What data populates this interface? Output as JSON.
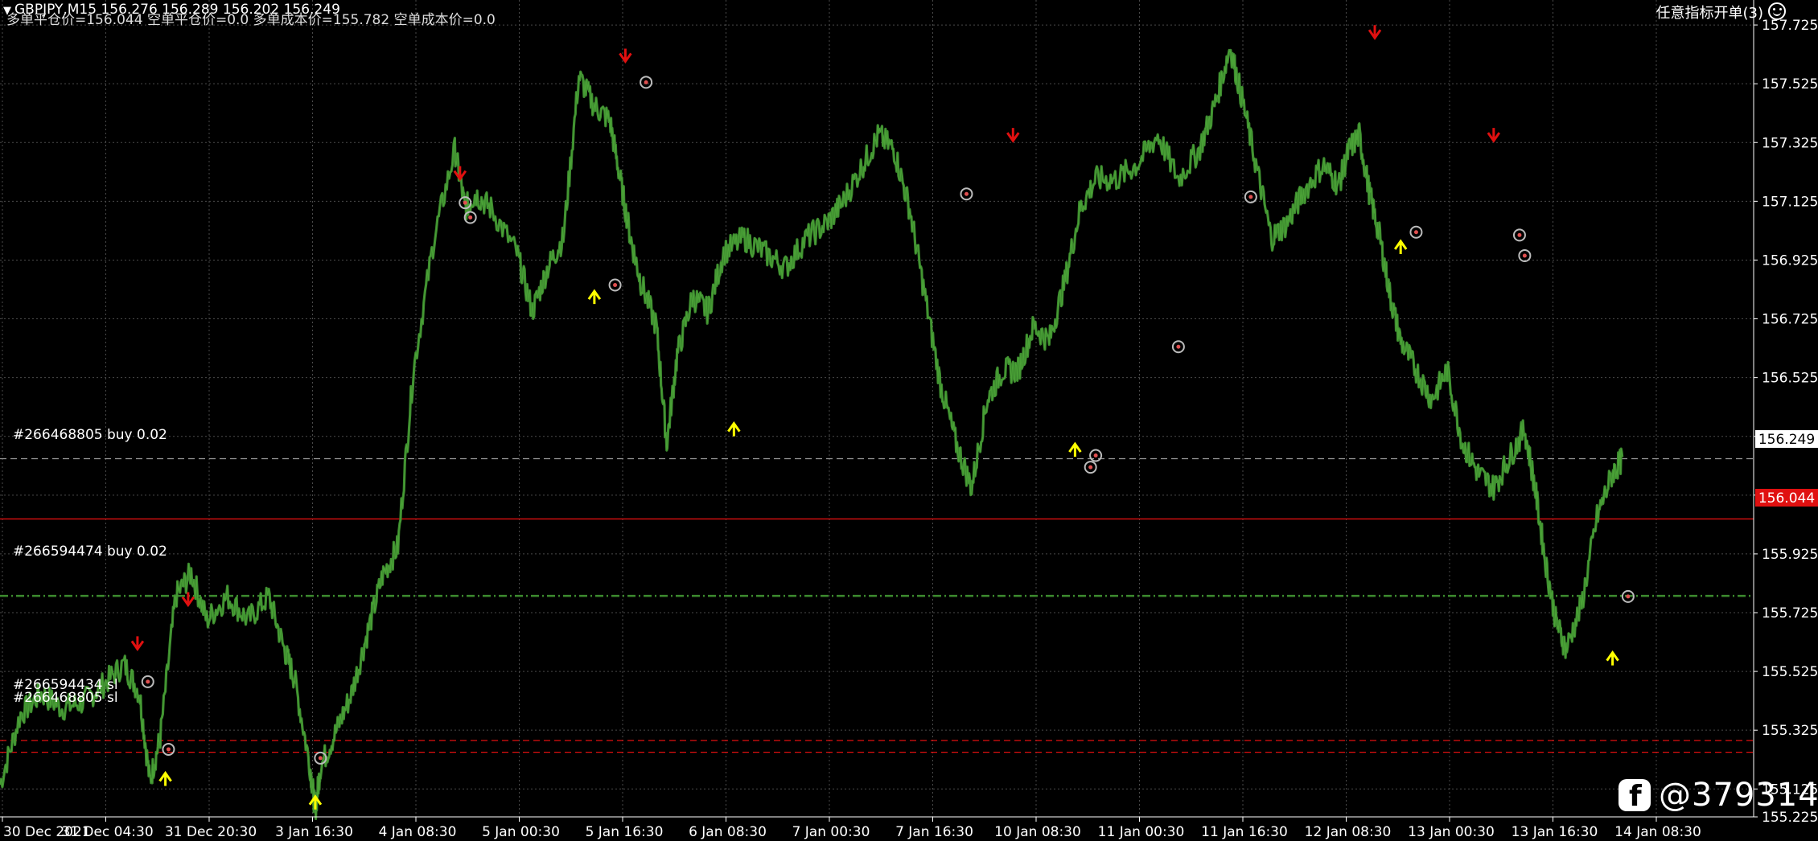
{
  "header": {
    "symbol_line": "GBPJPY,M15  156.276 156.289 156.202 156.249",
    "stats_line": "多单平仓价=156.044 空单平仓价=0.0 多单成本价=155.782 空单成本价=0.0"
  },
  "top_right": {
    "label": "任意指标开单(3)"
  },
  "order_labels": {
    "buy_top": "#266468805 buy 0.02",
    "buy_mid": "#266594474 buy 0.02",
    "sl_a": "#266594434 sl",
    "sl_b": "#266468805 sl"
  },
  "price_boxes": {
    "current": "156.249",
    "close_line": "156.044"
  },
  "watermark": {
    "text": "@379314"
  },
  "colors": {
    "background": "#000000",
    "candle": "#3c8a2e",
    "grid": "#4a4a4a",
    "close_line": "#e01010",
    "buy_arrow": "#ffff00",
    "sell_arrow": "#e01010"
  },
  "chart_data": {
    "type": "line",
    "symbol": "GBPJPY",
    "timeframe": "M15",
    "ylim": [
      155.03,
      157.81
    ],
    "y_ticks": [
      "157.725",
      "157.525",
      "157.325",
      "157.125",
      "156.925",
      "156.725",
      "156.525",
      "156.325",
      "156.125",
      "155.925",
      "155.725",
      "155.525",
      "155.325",
      "155.125",
      "155.225"
    ],
    "y_tick_values": [
      157.725,
      157.525,
      157.325,
      157.125,
      156.925,
      156.725,
      156.525,
      156.325,
      156.125,
      155.925,
      155.725,
      155.525,
      155.325,
      155.125,
      155.03
    ],
    "x_ticks": [
      "30 Dec 2021",
      "31 Dec 04:30",
      "31 Dec 20:30",
      "3 Jan 16:30",
      "4 Jan 08:30",
      "5 Jan 00:30",
      "5 Jan 16:30",
      "6 Jan 08:30",
      "7 Jan 00:30",
      "7 Jan 16:30",
      "10 Jan 08:30",
      "11 Jan 00:30",
      "11 Jan 16:30",
      "12 Jan 08:30",
      "13 Jan 00:30",
      "13 Jan 16:30",
      "14 Jan 08:30"
    ],
    "x_tick_index": [
      0,
      1,
      2,
      3,
      4,
      5,
      6,
      7,
      8,
      9,
      10,
      11,
      12,
      13,
      14,
      15,
      16
    ],
    "price_path": [
      [
        0,
        155.14
      ],
      [
        0.2,
        155.38
      ],
      [
        0.4,
        155.45
      ],
      [
        0.6,
        155.4
      ],
      [
        0.8,
        155.42
      ],
      [
        1.0,
        155.48
      ],
      [
        1.2,
        155.55
      ],
      [
        1.35,
        155.45
      ],
      [
        1.45,
        155.15
      ],
      [
        1.55,
        155.3
      ],
      [
        1.7,
        155.78
      ],
      [
        1.85,
        155.86
      ],
      [
        2.0,
        155.7
      ],
      [
        2.2,
        155.78
      ],
      [
        2.4,
        155.7
      ],
      [
        2.6,
        155.78
      ],
      [
        2.75,
        155.6
      ],
      [
        2.85,
        155.5
      ],
      [
        3.0,
        155.2
      ],
      [
        3.05,
        155.05
      ],
      [
        3.1,
        155.2
      ],
      [
        3.25,
        155.32
      ],
      [
        3.4,
        155.45
      ],
      [
        3.55,
        155.65
      ],
      [
        3.7,
        155.85
      ],
      [
        3.85,
        155.95
      ],
      [
        4.0,
        156.55
      ],
      [
        4.2,
        157.0
      ],
      [
        4.4,
        157.3
      ],
      [
        4.5,
        157.1
      ],
      [
        4.6,
        157.15
      ],
      [
        4.75,
        157.1
      ],
      [
        5.0,
        156.95
      ],
      [
        5.15,
        156.75
      ],
      [
        5.3,
        156.9
      ],
      [
        5.45,
        157.0
      ],
      [
        5.6,
        157.55
      ],
      [
        5.75,
        157.45
      ],
      [
        5.9,
        157.4
      ],
      [
        6.0,
        157.2
      ],
      [
        6.1,
        157.0
      ],
      [
        6.2,
        156.85
      ],
      [
        6.35,
        156.7
      ],
      [
        6.45,
        156.3
      ],
      [
        6.55,
        156.6
      ],
      [
        6.7,
        156.8
      ],
      [
        6.85,
        156.75
      ],
      [
        7.0,
        156.95
      ],
      [
        7.2,
        157.0
      ],
      [
        7.4,
        156.95
      ],
      [
        7.6,
        156.9
      ],
      [
        7.8,
        157.0
      ],
      [
        8.0,
        157.05
      ],
      [
        8.15,
        157.12
      ],
      [
        8.35,
        157.25
      ],
      [
        8.5,
        157.35
      ],
      [
        8.65,
        157.3
      ],
      [
        8.8,
        157.1
      ],
      [
        8.95,
        156.8
      ],
      [
        9.1,
        156.5
      ],
      [
        9.25,
        156.3
      ],
      [
        9.4,
        156.15
      ],
      [
        9.55,
        156.45
      ],
      [
        9.7,
        156.55
      ],
      [
        9.85,
        156.55
      ],
      [
        10.0,
        156.7
      ],
      [
        10.15,
        156.65
      ],
      [
        10.3,
        156.85
      ],
      [
        10.45,
        157.1
      ],
      [
        10.6,
        157.2
      ],
      [
        10.8,
        157.2
      ],
      [
        11.0,
        157.25
      ],
      [
        11.2,
        157.35
      ],
      [
        11.4,
        157.2
      ],
      [
        11.6,
        157.3
      ],
      [
        11.75,
        157.45
      ],
      [
        11.9,
        157.65
      ],
      [
        12.0,
        157.5
      ],
      [
        12.15,
        157.25
      ],
      [
        12.3,
        157.0
      ],
      [
        12.45,
        157.05
      ],
      [
        12.6,
        157.15
      ],
      [
        12.8,
        157.25
      ],
      [
        12.95,
        157.18
      ],
      [
        13.05,
        157.3
      ],
      [
        13.15,
        157.35
      ],
      [
        13.25,
        157.15
      ],
      [
        13.35,
        157.0
      ],
      [
        13.45,
        156.8
      ],
      [
        13.55,
        156.65
      ],
      [
        13.7,
        156.55
      ],
      [
        13.85,
        156.45
      ],
      [
        14.0,
        156.55
      ],
      [
        14.15,
        156.3
      ],
      [
        14.3,
        156.2
      ],
      [
        14.45,
        156.15
      ],
      [
        14.6,
        156.25
      ],
      [
        14.75,
        156.35
      ],
      [
        14.85,
        156.15
      ],
      [
        14.95,
        155.9
      ],
      [
        15.05,
        155.7
      ],
      [
        15.15,
        155.6
      ],
      [
        15.3,
        155.75
      ],
      [
        15.45,
        156.05
      ],
      [
        15.6,
        156.2
      ],
      [
        15.7,
        156.25
      ]
    ],
    "horizontal_levels": [
      {
        "value": 156.249,
        "style": "dashed"
      },
      {
        "value": 156.044,
        "style": "solid"
      },
      {
        "value": 155.782,
        "style": "dashdot"
      },
      {
        "value": 155.29,
        "style": "dashed"
      },
      {
        "value": 155.25,
        "style": "dashed"
      }
    ],
    "sell_arrows": [
      [
        1.33,
        155.62
      ],
      [
        1.82,
        155.77
      ],
      [
        4.45,
        157.22
      ],
      [
        6.05,
        157.62
      ],
      [
        9.8,
        157.35
      ],
      [
        13.3,
        157.7
      ],
      [
        14.45,
        157.35
      ]
    ],
    "buy_arrows": [
      [
        1.6,
        155.16
      ],
      [
        3.05,
        155.08
      ],
      [
        5.75,
        156.8
      ],
      [
        7.1,
        156.35
      ],
      [
        10.4,
        156.28
      ],
      [
        13.55,
        156.97
      ],
      [
        15.6,
        155.57
      ]
    ],
    "order_markers": [
      [
        1.43,
        155.49
      ],
      [
        1.63,
        155.26
      ],
      [
        3.1,
        155.23
      ],
      [
        4.5,
        157.12
      ],
      [
        4.55,
        157.07
      ],
      [
        5.95,
        156.84
      ],
      [
        6.25,
        157.53
      ],
      [
        9.35,
        157.15
      ],
      [
        10.55,
        156.22
      ],
      [
        10.6,
        156.26
      ],
      [
        11.4,
        156.63
      ],
      [
        12.1,
        157.14
      ],
      [
        13.7,
        157.02
      ],
      [
        14.7,
        157.01
      ],
      [
        14.75,
        156.94
      ],
      [
        15.75,
        155.78
      ]
    ]
  }
}
